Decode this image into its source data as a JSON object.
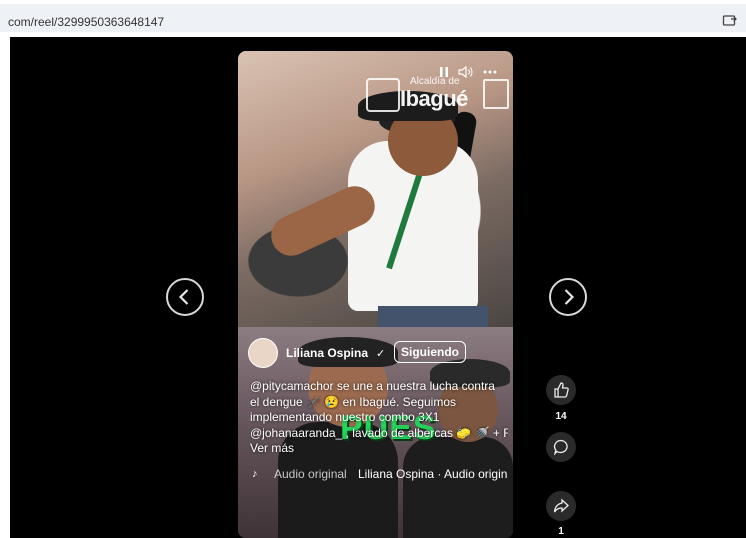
{
  "browser": {
    "url": "com/reel/3299950363648147",
    "icon": "share-screen-icon"
  },
  "video": {
    "logo_small": "Alcaldía de",
    "logo_big": "Ibagué",
    "overlay_text": "PUES",
    "controls": {
      "pause_icon": "pause-icon",
      "volume_icon": "volume-icon",
      "more_icon": "more-icon"
    },
    "author": "Liliana Ospina",
    "verified_glyph": "✓",
    "follow_label": "Siguiendo",
    "caption_lines": [
      "@pitycamachor se une a nuestra lucha contra",
      "el dengue 🦟 😢 en Ibagué. Seguimos",
      "implementando nuestro combo 3X1",
      "@johanaaranda_ , lavado de albercas 🧽 🚿 + R..."
    ],
    "see_more": "Ver más",
    "audio_a": "Audio original",
    "audio_b": "Liliana Ospina · Audio origin"
  },
  "actions": {
    "like_count": "14",
    "share_count": "1"
  },
  "colors": {
    "overlay_green": "#24d45a",
    "stage_bg": "#000000"
  }
}
